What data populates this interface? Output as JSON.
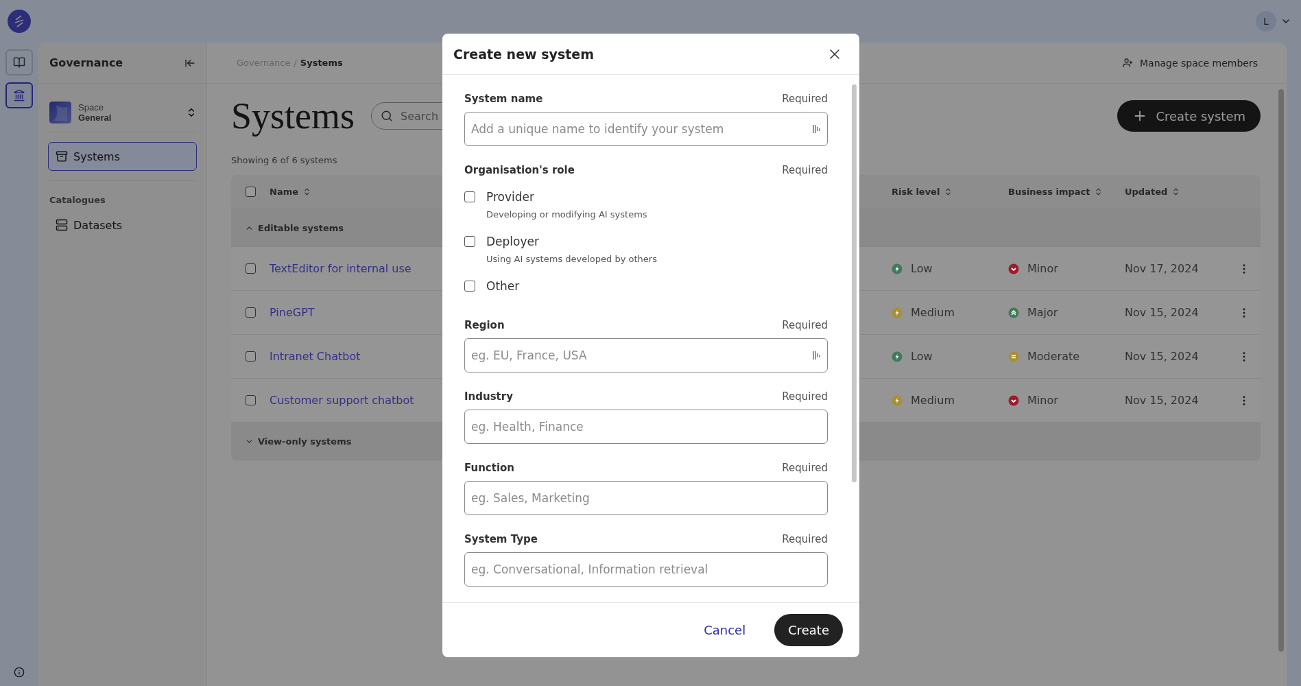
{
  "rail": [
    {
      "kind": "book",
      "selected": false
    },
    {
      "kind": "bank",
      "selected": true
    }
  ],
  "avatar": {
    "initial": "L"
  },
  "sidebar": {
    "title": "Governance",
    "space": {
      "label": "Space",
      "name": "General"
    },
    "nav": [
      {
        "label": "Systems",
        "selected": true
      }
    ],
    "sections": [
      {
        "title": "Catalogues",
        "items": [
          {
            "label": "Datasets",
            "selected": false
          }
        ]
      }
    ]
  },
  "breadcrumb": {
    "separator": "/",
    "items": [
      {
        "label": "Governance",
        "current": false
      },
      {
        "label": "Systems",
        "current": true
      }
    ]
  },
  "header_action": "Manage space members",
  "page": {
    "title": "Systems",
    "search_placeholder": "Search",
    "create_button": "Create system",
    "count": "Showing 6 of 6 systems"
  },
  "table": {
    "select_all_checked": false,
    "columns": [
      {
        "label": "Name"
      },
      {
        "label": "Risk level"
      },
      {
        "label": "Business impact"
      },
      {
        "label": "Updated"
      }
    ],
    "groups": [
      {
        "label": "Editable systems",
        "expanded": true,
        "rows": [
          {
            "name": "TextEditor for internal use",
            "checked": false,
            "risk": {
              "label": "Low",
              "color": "#3f7a5a"
            },
            "impact": {
              "label": "Minor",
              "kind": "down",
              "color": "#9c1c28"
            },
            "updated": "Nov 17, 2024"
          },
          {
            "name": "PineGPT",
            "checked": false,
            "risk": {
              "label": "Medium",
              "color": "#a88f35"
            },
            "impact": {
              "label": "Major",
              "kind": "up",
              "color": "#3f7a5a"
            },
            "updated": "Nov 15, 2024"
          },
          {
            "name": "Intranet Chatbot",
            "checked": false,
            "risk": {
              "label": "Low",
              "color": "#3f7a5a"
            },
            "impact": {
              "label": "Moderate",
              "kind": "equal",
              "color": "#a88f35"
            },
            "updated": "Nov 15, 2024"
          },
          {
            "name": "Customer support chatbot",
            "checked": false,
            "risk": {
              "label": "Medium",
              "color": "#a88f35"
            },
            "impact": {
              "label": "Minor",
              "kind": "down",
              "color": "#9c1c28"
            },
            "updated": "Nov 15, 2024"
          }
        ]
      },
      {
        "label": "View-only systems",
        "expanded": false
      }
    ]
  },
  "modal": {
    "title": "Create new system",
    "fields": [
      {
        "kind": "text",
        "label": "System name",
        "note": "Required",
        "placeholder": "Add a unique name to identify your system",
        "trailing_icon": true
      },
      {
        "kind": "choices",
        "label": "Organisation's role",
        "note": "Required",
        "options": [
          {
            "label": "Provider",
            "description": "Developing or modifying AI systems",
            "checked": false
          },
          {
            "label": "Deployer",
            "description": "Using AI systems developed by others",
            "checked": false
          },
          {
            "label": "Other",
            "checked": false
          }
        ]
      },
      {
        "kind": "text",
        "label": "Region",
        "note": "Required",
        "placeholder": "eg. EU, France, USA",
        "trailing_icon": true
      },
      {
        "kind": "text",
        "label": "Industry",
        "note": "Required",
        "placeholder": "eg. Health, Finance"
      },
      {
        "kind": "text",
        "label": "Function",
        "note": "Required",
        "placeholder": "eg. Sales, Marketing"
      },
      {
        "kind": "text",
        "label": "System Type",
        "note": "Required",
        "placeholder": "eg. Conversational, Information retrieval"
      }
    ],
    "buttons": [
      {
        "label": "Cancel",
        "kind": "link"
      },
      {
        "label": "Create",
        "kind": "primary"
      }
    ]
  }
}
